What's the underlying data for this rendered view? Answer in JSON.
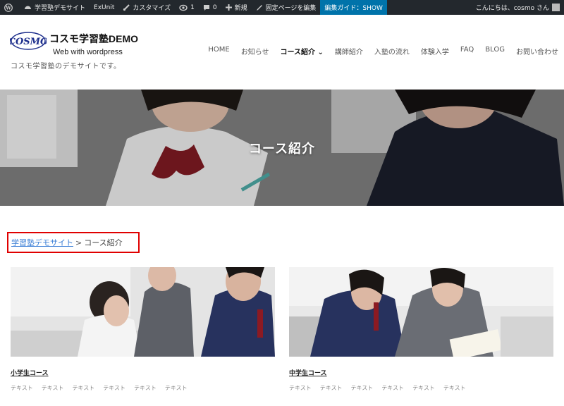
{
  "adminbar": {
    "site_name": "学習塾デモサイト",
    "exunit": "ExUnit",
    "customize": "カスタマイズ",
    "updates": "1",
    "comments": "0",
    "new": "新規",
    "edit_page": "固定ページを編集",
    "edit_guide": "編集ガイド：SHOW",
    "greeting": "こんにちは、cosmo さん"
  },
  "header": {
    "logo_text": "COSMO",
    "site_title": "コスモ学習塾DEMO",
    "site_subtitle": "Web with wordpress",
    "description": "コスモ学習塾のデモサイトです。"
  },
  "nav": {
    "items": [
      {
        "label": "HOME"
      },
      {
        "label": "お知らせ"
      },
      {
        "label": "コース紹介 ⌄"
      },
      {
        "label": "講師紹介"
      },
      {
        "label": "入塾の流れ"
      },
      {
        "label": "体験入学"
      },
      {
        "label": "FAQ"
      },
      {
        "label": "BLOG"
      },
      {
        "label": "お問い合わせ"
      }
    ]
  },
  "hero": {
    "title": "コース紹介"
  },
  "breadcrumb": {
    "home": "学習塾デモサイト",
    "separator": ">",
    "current": "コース紹介"
  },
  "courses": [
    {
      "title": "小学生コース",
      "tags": [
        "テキスト",
        "テキスト",
        "テキスト",
        "テキスト",
        "テキスト",
        "テキスト"
      ]
    },
    {
      "title": "中学生コース",
      "tags": [
        "テキスト",
        "テキスト",
        "テキスト",
        "テキスト",
        "テキスト",
        "テキスト"
      ]
    }
  ],
  "colors": {
    "adminbar_bg": "#23282d",
    "adminbar_highlight": "#0073aa",
    "breadcrumb_link": "#3c7fd6",
    "highlight_border": "#e00000"
  }
}
